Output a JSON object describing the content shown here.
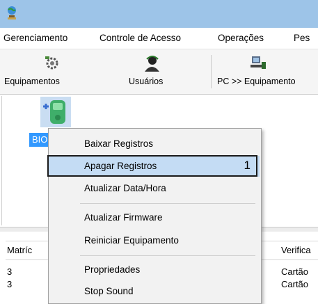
{
  "menubar": {
    "items": [
      "Gerenciamento",
      "Controle de Acesso",
      "Operações",
      "Pes"
    ]
  },
  "toolbar": {
    "buttons": [
      {
        "label": "Equipamentos",
        "icon": "equipment-icon"
      },
      {
        "label": "Usuários",
        "icon": "users-icon"
      },
      {
        "label": "PC >> Equipamento",
        "icon": "pc-to-device-icon"
      }
    ]
  },
  "device": {
    "label": "BIO",
    "icon": "biometric-device-icon"
  },
  "grid": {
    "columns": [
      "Matríc",
      "Verifica"
    ],
    "rows": [
      {
        "matricula": "3",
        "verificacao": "Cartão"
      },
      {
        "matricula": "3",
        "verificacao": "Cartão"
      }
    ]
  },
  "context_menu": {
    "items": [
      "Baixar Registros",
      "Apagar Registros",
      "Atualizar Data/Hora",
      "Atualizar Firmware",
      "Reiniciar Equipamento",
      "Propriedades",
      "Stop Sound"
    ],
    "highlighted": "Apagar Registros",
    "callout_number": "1"
  },
  "colors": {
    "titlebar": "#9dc4e8",
    "selection": "#3399ff",
    "menu_highlight": "#c4dcf4"
  }
}
